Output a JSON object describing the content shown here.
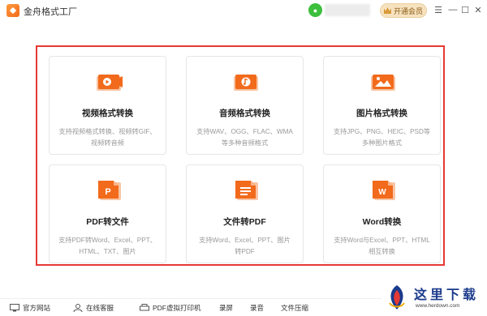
{
  "app": {
    "title": "金舟格式工厂"
  },
  "header": {
    "user_name": "",
    "vip_label": "开通会员",
    "menu_label": "☰",
    "minimize_label": "—",
    "maximize_label": "☐",
    "close_label": "✕"
  },
  "cards": [
    {
      "title": "视频格式转换",
      "desc_line1": "支持视频格式转换、视频转GIF、",
      "desc_line2": "视频转音频",
      "icon": "video-icon"
    },
    {
      "title": "音频格式转换",
      "desc_line1": "支持WAV、OGG、FLAC、WMA",
      "desc_line2": "等多种音频格式",
      "icon": "audio-icon"
    },
    {
      "title": "图片格式转换",
      "desc_line1": "支持JPG、PNG、HEIC、PSD等",
      "desc_line2": "多种图片格式",
      "icon": "image-icon"
    },
    {
      "title": "PDF转文件",
      "desc_line1": "支持PDF转Word、Excel、PPT、",
      "desc_line2": "HTML、TXT、图片",
      "icon": "pdf-icon",
      "badge": "P"
    },
    {
      "title": "文件转PDF",
      "desc_line1": "支持Word、Excel、PPT、图片",
      "desc_line2": "转PDF",
      "icon": "doc-to-pdf-icon"
    },
    {
      "title": "Word转换",
      "desc_line1": "支持Word与Excel、PPT、HTML",
      "desc_line2": "相互转换",
      "icon": "word-icon",
      "badge": "W"
    }
  ],
  "bottom": {
    "website": "官方网站",
    "service": "在线客服",
    "printer": "PDF虚拟打印机",
    "record_screen": "录屏",
    "record_audio": "录音",
    "compress": "文件压缩"
  },
  "watermark": {
    "text": "这里下载",
    "url": "www.herdown.com"
  },
  "colors": {
    "accent": "#f26a1b",
    "frame": "#e53935",
    "vip_bg": "#f6e2bf"
  }
}
